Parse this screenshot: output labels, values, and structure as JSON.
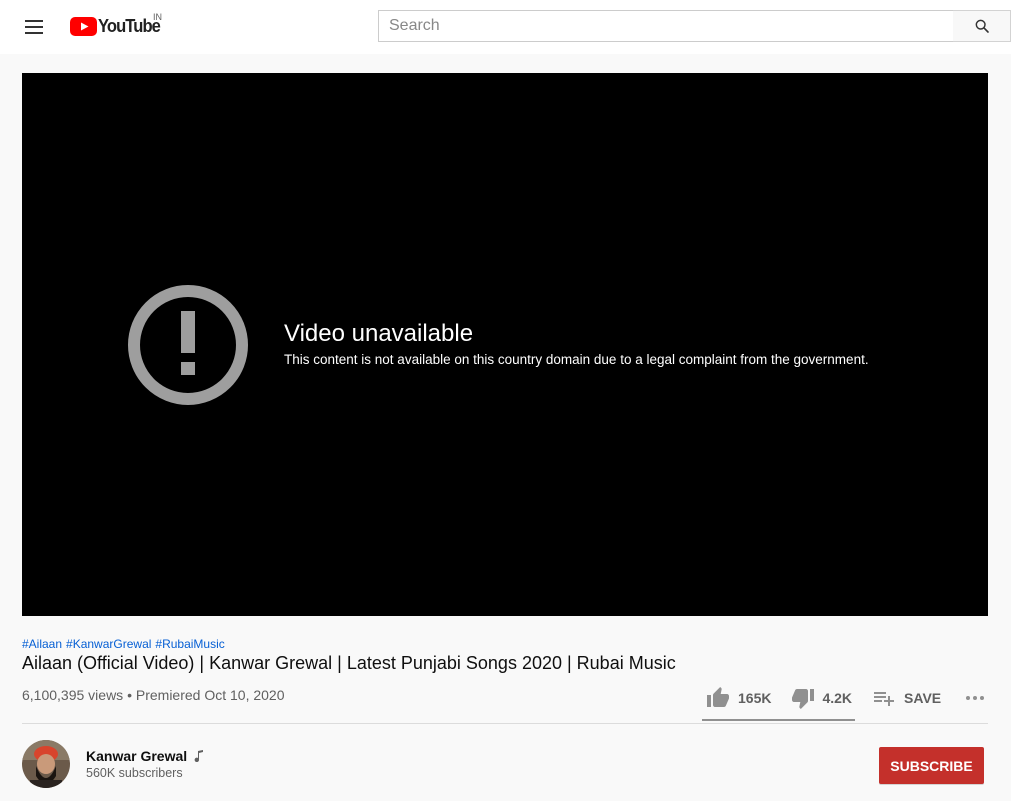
{
  "masthead": {
    "logo_text": "YouTube",
    "country_code": "IN",
    "search": {
      "placeholder": "Search",
      "value": ""
    },
    "icons": [
      "menu-icon",
      "youtube-logo",
      "search-icon"
    ]
  },
  "player": {
    "error_title": "Video unavailable",
    "error_reason": "This content is not available on this country domain due to a legal complaint from the government.",
    "icon": "error-exclamation-icon"
  },
  "video": {
    "hashtags": [
      "#Ailaan",
      "#KanwarGrewal",
      "#RubaiMusic"
    ],
    "title": "Ailaan (Official Video) | Kanwar Grewal | Latest Punjabi Songs 2020 | Rubai Music",
    "meta": "6,100,395 views • Premiered Oct 10, 2020",
    "views": "6,100,395 views",
    "premiered": "Premiered Oct 10, 2020"
  },
  "actions": {
    "likes": "165K",
    "dislikes": "4.2K",
    "save_label": "SAVE",
    "like_ratio": 0.975,
    "icons": [
      "thumb-up-icon",
      "thumb-down-icon",
      "playlist-add-icon",
      "more-icon"
    ]
  },
  "channel": {
    "name": "Kanwar Grewal",
    "subscribers": "560K subscribers",
    "subscribe_label": "SUBSCRIBE",
    "badge_icon": "music-note-icon"
  },
  "colors": {
    "brand_red": "#ff0000",
    "subscribe_red": "#c4302b",
    "link_blue": "#065fd4",
    "page_bg": "#f9f9f9",
    "player_bg": "#000000",
    "error_icon_gray": "#9e9e9e"
  }
}
